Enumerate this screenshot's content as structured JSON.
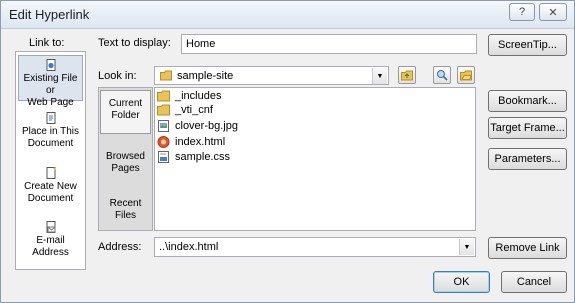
{
  "dialog": {
    "title": "Edit Hyperlink",
    "help_label": "?",
    "close_label": "✕"
  },
  "link_to": {
    "label": "Link to:",
    "items": [
      {
        "line1": "Existing File or",
        "line2": "Web Page",
        "icon": "file-web-icon"
      },
      {
        "line1": "Place in This",
        "line2": "Document",
        "icon": "place-in-document-icon"
      },
      {
        "line1": "Create New",
        "line2": "Document",
        "icon": "new-document-icon"
      },
      {
        "line1": "E-mail",
        "line2": "Address",
        "icon": "email-icon"
      }
    ]
  },
  "text_to_display": {
    "label": "Text to display:",
    "value": "Home"
  },
  "look_in": {
    "label": "Look in:",
    "value": "sample-site",
    "sections": [
      {
        "line1": "Current",
        "line2": "Folder"
      },
      {
        "line1": "Browsed",
        "line2": "Pages"
      },
      {
        "line1": "Recent",
        "line2": "Files"
      }
    ],
    "files": [
      {
        "name": "_includes",
        "icon": "folder-icon"
      },
      {
        "name": "_vti_cnf",
        "icon": "folder-icon"
      },
      {
        "name": "clover-bg.jpg",
        "icon": "image-file-icon"
      },
      {
        "name": "index.html",
        "icon": "html-file-icon"
      },
      {
        "name": "sample.css",
        "icon": "css-file-icon"
      }
    ]
  },
  "address": {
    "label": "Address:",
    "value": "..\\index.html"
  },
  "buttons": {
    "screentip": "ScreenTip...",
    "bookmark": "Bookmark...",
    "target_frame": "Target Frame...",
    "parameters": "Parameters...",
    "remove_link": "Remove Link",
    "ok": "OK",
    "cancel": "Cancel"
  }
}
